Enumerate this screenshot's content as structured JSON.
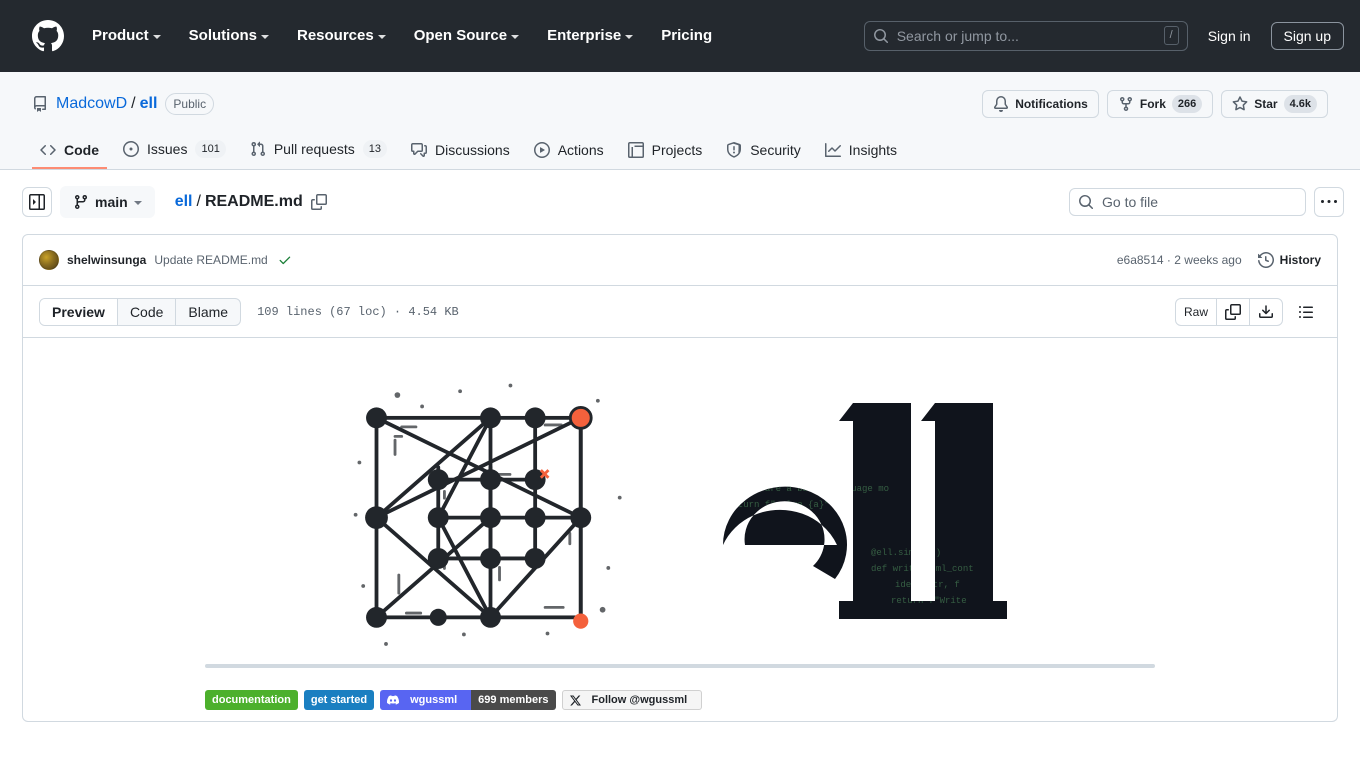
{
  "header": {
    "logo_icon": "github-mark-icon",
    "nav": [
      {
        "label": "Product",
        "has_caret": true
      },
      {
        "label": "Solutions",
        "has_caret": true
      },
      {
        "label": "Resources",
        "has_caret": true
      },
      {
        "label": "Open Source",
        "has_caret": true
      },
      {
        "label": "Enterprise",
        "has_caret": true
      },
      {
        "label": "Pricing",
        "has_caret": false
      }
    ],
    "search": {
      "placeholder": "Search or jump to...",
      "shortcut": "/"
    },
    "sign_in": "Sign in",
    "sign_up": "Sign up"
  },
  "repo": {
    "owner": "MadcowD",
    "separator": "/",
    "name": "ell",
    "visibility": "Public",
    "actions": {
      "notifications": "Notifications",
      "fork_label": "Fork",
      "fork_count": "266",
      "star_label": "Star",
      "star_count": "4.6k"
    },
    "tabs": [
      {
        "label": "Code",
        "icon": "code-icon",
        "count": null,
        "active": true
      },
      {
        "label": "Issues",
        "icon": "issue-opened-icon",
        "count": "101",
        "active": false
      },
      {
        "label": "Pull requests",
        "icon": "git-pull-request-icon",
        "count": "13",
        "active": false
      },
      {
        "label": "Discussions",
        "icon": "comment-discussion-icon",
        "count": null,
        "active": false
      },
      {
        "label": "Actions",
        "icon": "play-icon",
        "count": null,
        "active": false
      },
      {
        "label": "Projects",
        "icon": "table-icon",
        "count": null,
        "active": false
      },
      {
        "label": "Security",
        "icon": "shield-icon",
        "count": null,
        "active": false
      },
      {
        "label": "Insights",
        "icon": "graph-icon",
        "count": null,
        "active": false
      }
    ]
  },
  "toolbar": {
    "sidebar_toggle_icon": "sidebar-expand-icon",
    "branch": "main",
    "breadcrumb_repo": "ell",
    "breadcrumb_sep": "/",
    "breadcrumb_file": "README.md",
    "copy_path_icon": "copy-icon",
    "goto_file_placeholder": "Go to file",
    "more_options": "…"
  },
  "commit": {
    "author": "shelwinsunga",
    "message": "Update README.md",
    "status_icon": "check-icon",
    "sha": "e6a8514",
    "dot": "·",
    "time": "2 weeks ago",
    "history_label": "History"
  },
  "file_view": {
    "tabs": [
      {
        "label": "Preview",
        "active": true
      },
      {
        "label": "Code",
        "active": false
      },
      {
        "label": "Blame",
        "active": false
      }
    ],
    "meta": "109 lines (67 loc) · 4.54 KB",
    "raw_label": "Raw",
    "copy_icon": "copy-icon",
    "download_icon": "download-icon",
    "outline_icon": "list-unordered-icon"
  },
  "readme": {
    "logo_alt": "ell network graph logo",
    "wordmark_alt": "ell wordmark",
    "badges": [
      {
        "name": "documentation",
        "label": "documentation",
        "style": "badge-doc",
        "color": "#4cb02c"
      },
      {
        "name": "get-started",
        "label": "get started",
        "style": "badge-start",
        "color": "#1a7fc1"
      },
      {
        "name": "discord",
        "label_left": "wgussml",
        "label_right": "699 members",
        "icon": "discord-icon",
        "color_left": "#5865f2",
        "color_right": "#4a4a4a"
      },
      {
        "name": "twitter-follow",
        "label": "Follow @wgussml",
        "icon": "x-icon",
        "color": "#f5f5f5"
      }
    ]
  }
}
